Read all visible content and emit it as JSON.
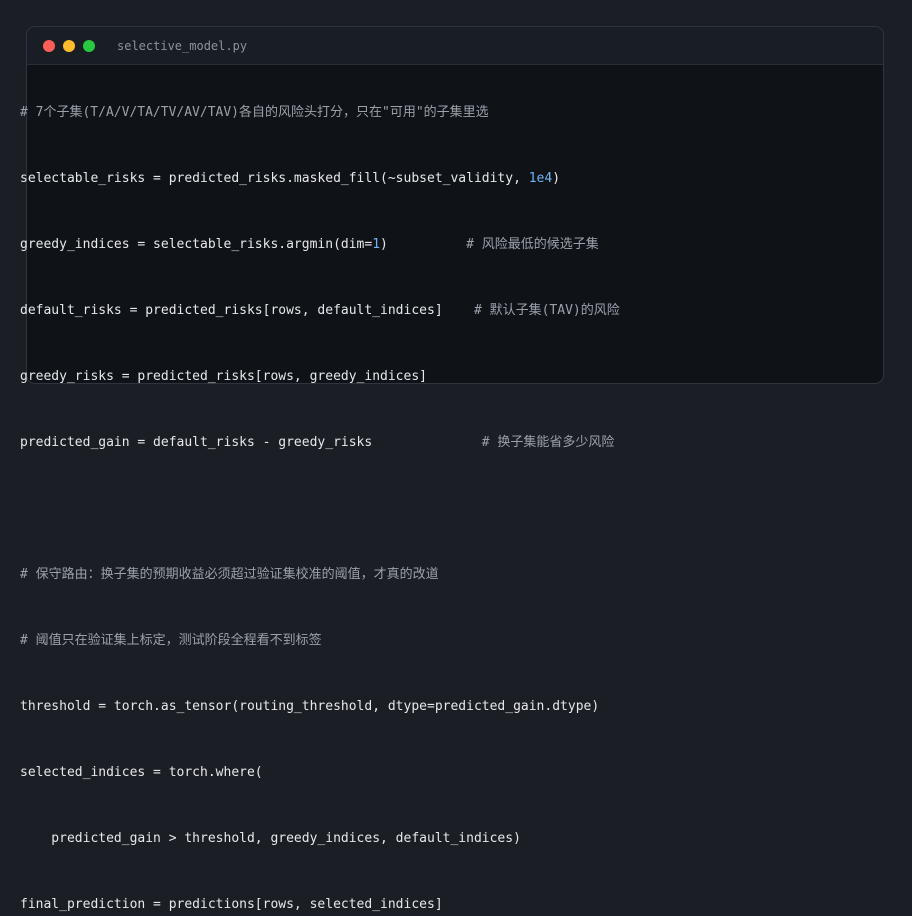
{
  "window": {
    "filename": "selective_model.py",
    "colors": {
      "close": "#ff5f57",
      "minimize": "#febc2e",
      "maximize": "#28c840",
      "background": "#0f1217",
      "number": "#6fb3f5",
      "comment": "#9aa1ab"
    }
  },
  "code": {
    "l1": "# 7个子集(T/A/V/TA/TV/AV/TAV)各自的风险头打分，只在\"可用\"的子集里选",
    "l2a": "selectable_risks = predicted_risks.masked_fill(~subset_validity, ",
    "l2n": "1e4",
    "l2b": ")",
    "l3a": "greedy_indices = selectable_risks.argmin(dim=",
    "l3n": "1",
    "l3b": ")          ",
    "l3c": "# 风险最低的候选子集",
    "l4a": "default_risks = predicted_risks[rows, default_indices]    ",
    "l4c": "# 默认子集(TAV)的风险",
    "l5": "greedy_risks = predicted_risks[rows, greedy_indices]",
    "l6a": "predicted_gain = default_risks - greedy_risks              ",
    "l6c": "# 换子集能省多少风险",
    "l8": "# 保守路由：换子集的预期收益必须超过验证集校准的阈值，才真的改道",
    "l9": "# 阈值只在验证集上标定，测试阶段全程看不到标签",
    "l10": "threshold = torch.as_tensor(routing_threshold, dtype=predicted_gain.dtype)",
    "l11": "selected_indices = torch.where(",
    "l12": "    predicted_gain > threshold, greedy_indices, default_indices)",
    "l13": "final_prediction = predictions[rows, selected_indices]"
  }
}
